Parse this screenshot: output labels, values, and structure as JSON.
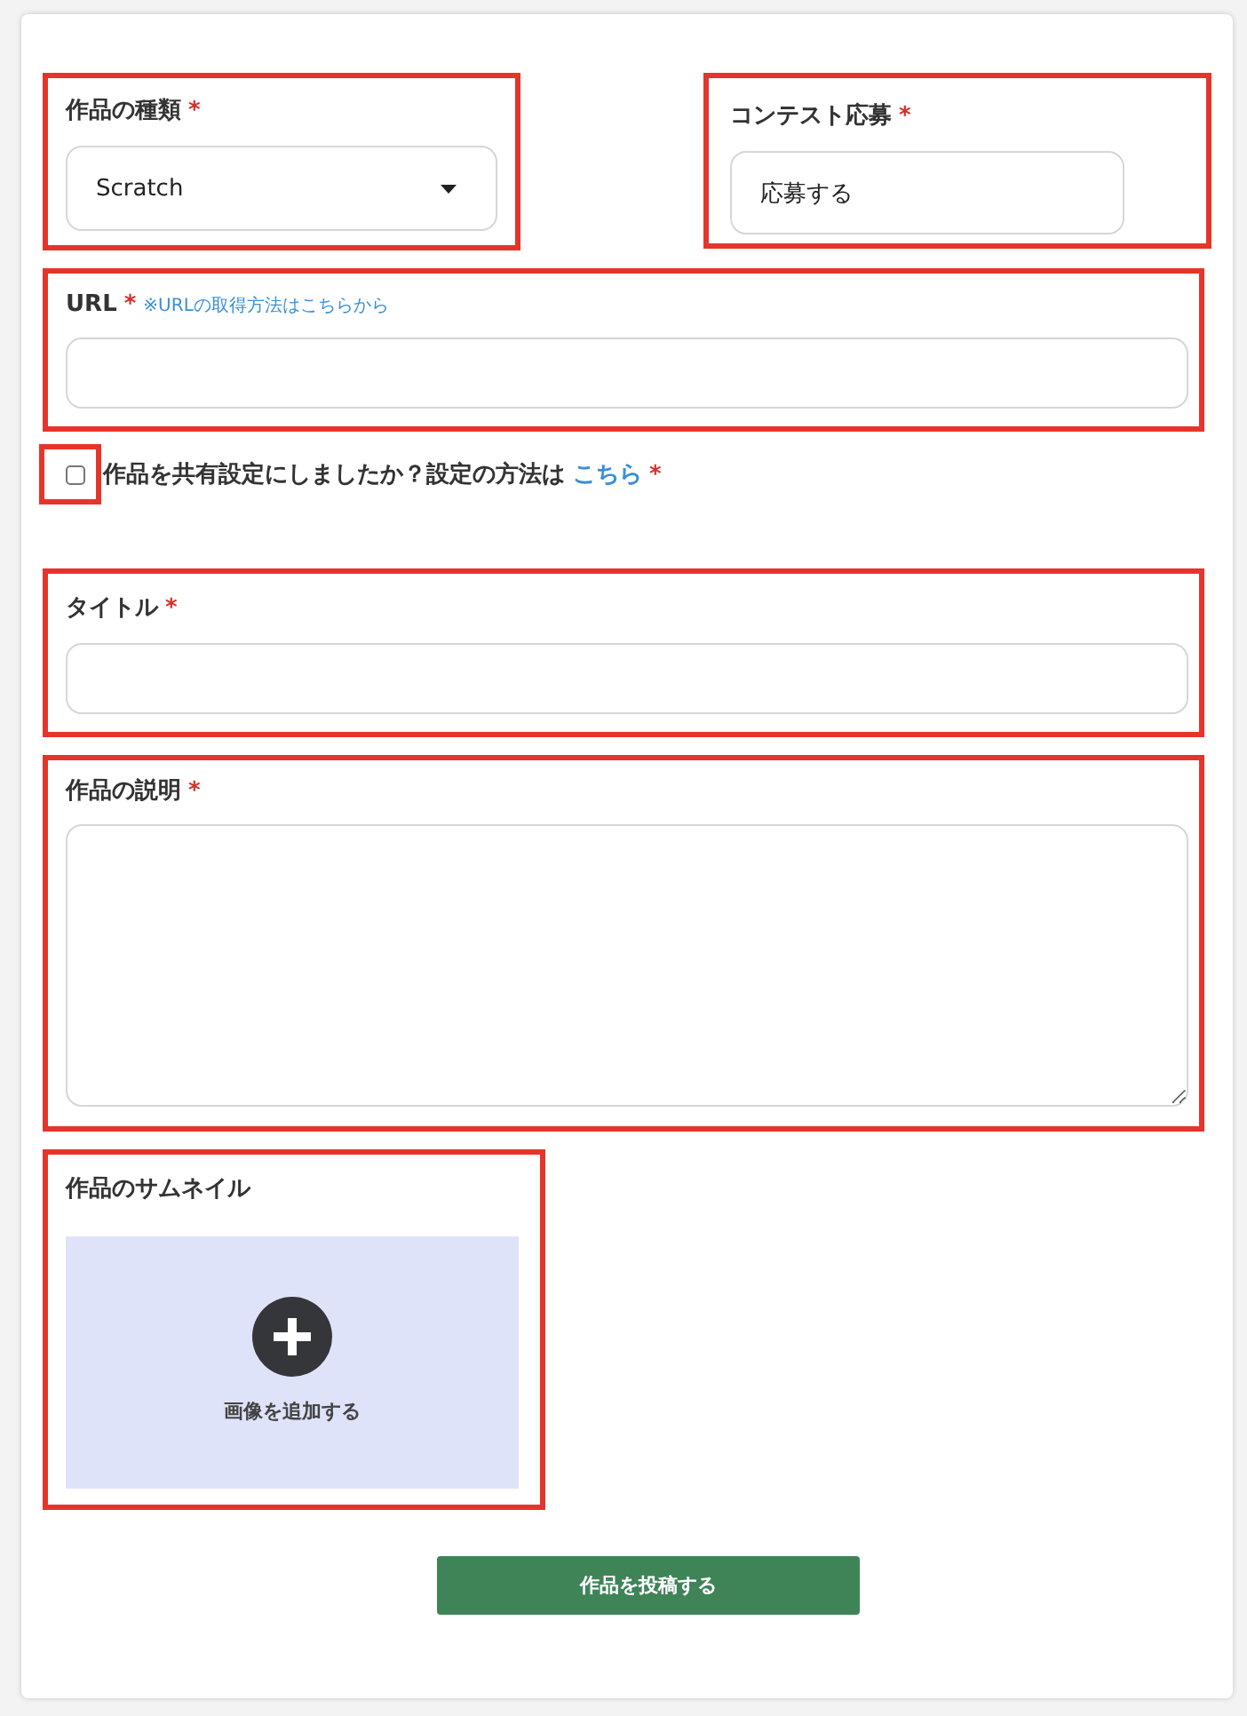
{
  "rows": [
    [
      {
        "kind": "select",
        "label": "作品の種類",
        "required_mark": "*",
        "value": "Scratch",
        "highlighted": true
      },
      {
        "kind": "text",
        "label": "コンテスト応募",
        "required_mark": "*",
        "value": "応募する",
        "highlighted": true
      }
    ],
    [
      {
        "kind": "text",
        "label": "URL",
        "required_mark": "*",
        "note": "※URLの取得方法はこちらから",
        "highlighted": true
      }
    ],
    [
      {
        "kind": "checkbox",
        "label": "作品を共有設定にしましたか？設定の方法は",
        "link": "こちら",
        "required_mark": "*",
        "checked": false,
        "highlighted": true
      }
    ],
    [
      {
        "kind": "text",
        "label": "タイトル",
        "required_mark": "*",
        "highlighted": true
      }
    ],
    [
      {
        "kind": "textarea",
        "label": "作品の説明",
        "required_mark": "*",
        "highlighted": true
      }
    ],
    [
      {
        "kind": "image",
        "label": "作品のサムネイル",
        "action": "画像を追加する",
        "highlighted": true
      }
    ]
  ],
  "submit": {
    "label": "作品を投稿する"
  }
}
